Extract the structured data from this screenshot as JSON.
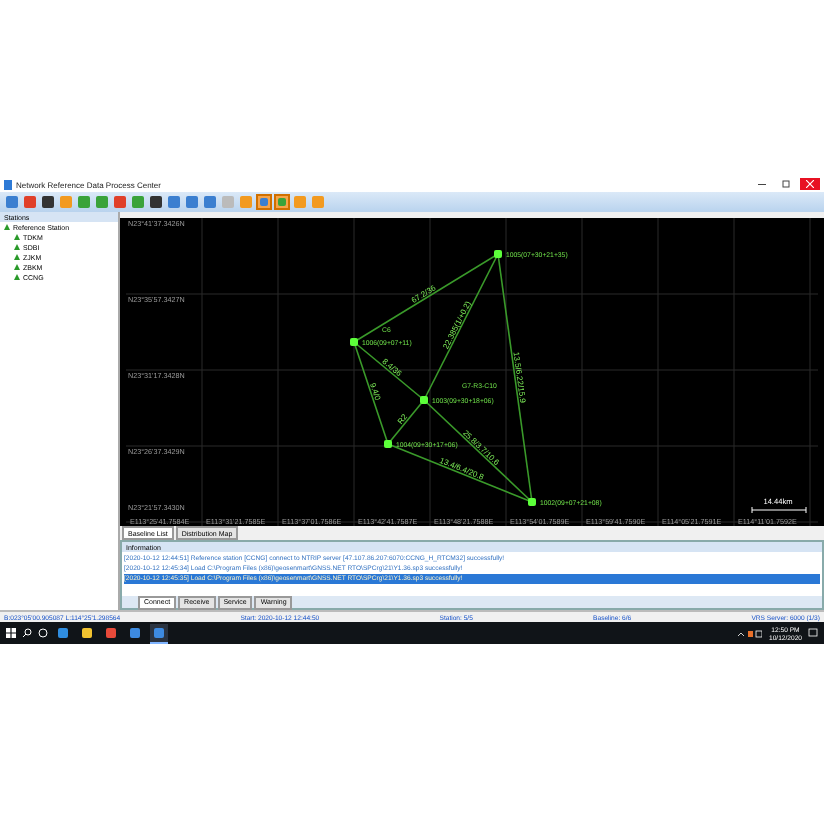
{
  "window": {
    "title": "Network Reference Data Process Center"
  },
  "toolbar": [
    {
      "kind": "blue",
      "selected": false
    },
    {
      "kind": "red",
      "selected": false
    },
    {
      "kind": "dark",
      "selected": false
    },
    {
      "kind": "orange",
      "selected": false
    },
    {
      "kind": "green",
      "selected": false
    },
    {
      "kind": "green",
      "selected": false
    },
    {
      "kind": "red",
      "selected": false
    },
    {
      "kind": "green",
      "selected": false
    },
    {
      "kind": "dark",
      "selected": false
    },
    {
      "kind": "blue",
      "selected": false
    },
    {
      "kind": "blue",
      "selected": false
    },
    {
      "kind": "blue",
      "selected": false
    },
    {
      "kind": "grey",
      "selected": false
    },
    {
      "kind": "orange",
      "selected": false
    },
    {
      "kind": "blue",
      "selected": true
    },
    {
      "kind": "green",
      "selected": true
    },
    {
      "kind": "orange",
      "selected": false
    },
    {
      "kind": "orange",
      "selected": false
    }
  ],
  "stations": {
    "title": "Stations",
    "root": "Reference Station",
    "children": [
      "TDKM",
      "SDBI",
      "ZJKM",
      "ZBKM",
      "CCNG"
    ]
  },
  "map": {
    "y_labels": [
      "N23°41'37.3426N",
      "N23°35'57.3427N",
      "N23°31'17.3428N",
      "N23°26'37.3429N",
      "N23°21'57.3430N"
    ],
    "x_labels": [
      "E113°25'41.7584E",
      "E113°31'21.7585E",
      "E113°37'01.7586E",
      "E113°42'41.7587E",
      "E113°48'21.7588E",
      "E113°54'01.7589E",
      "E113°59'41.7590E",
      "E114°05'21.7591E",
      "E114°11'01.7592E"
    ],
    "nodes": [
      {
        "label": "1005(07+30+21+35)"
      },
      {
        "label": "1006(09+07+11)"
      },
      {
        "label": "1003(09+30+18+06)"
      },
      {
        "label": "1004(09+30+17+06)"
      },
      {
        "label": "1002(09+07+21+08)"
      }
    ],
    "notes": [
      "C6",
      "G7-R3-C10"
    ],
    "edges": [
      {
        "label": "67.2/36"
      },
      {
        "label": "22.385(1/+0.2)"
      },
      {
        "label": "13.5/6.22/15.9"
      },
      {
        "label": "8.4/36"
      },
      {
        "label": "9.4/0"
      },
      {
        "label": "R2"
      },
      {
        "label": "25.8/3.7/10.6"
      },
      {
        "label": "13.4/6.4/20.8"
      }
    ],
    "scale": "14.44km"
  },
  "view_tabs": [
    {
      "label": "Baseline List",
      "selected": true
    },
    {
      "label": "Distribution Map",
      "selected": false
    }
  ],
  "information": {
    "title": "Information",
    "lines": [
      {
        "text": "[2020-10-12 12:44:51] Reference station [CCNG] connect to NTRIP server [47.107.86.207:6070:CCNG_H_RTCM32] successfully!",
        "selected": false
      },
      {
        "text": "[2020-10-12 12:45:34] Load C:\\Program Files (x86)\\geosenmart\\GNSS.NET RTO\\SPCrg\\21\\Y1.36.sp3 successfully!",
        "selected": false
      },
      {
        "text": "[2020-10-12 12:45:35] Load C:\\Program Files (x86)\\geosenmart\\GNSS.NET RTO\\SPCrg\\21\\Y1.36.sp3 successfully!",
        "selected": true
      }
    ]
  },
  "log_tabs": [
    {
      "label": "Connect",
      "selected": true
    },
    {
      "label": "Receive",
      "selected": false
    },
    {
      "label": "Service",
      "selected": false
    },
    {
      "label": "Warning",
      "selected": false
    }
  ],
  "status_bar": [
    "B:023°05'00.905087  L:114°25'1.298564",
    "Start: 2020-10-12 12:44:50",
    "Station: 5/5",
    "Baseline: 6/6",
    "VRS Server: 6000 (1/3)"
  ],
  "taskbar": {
    "apps": [
      {
        "kind": "edge",
        "selected": false
      },
      {
        "kind": "folder",
        "selected": false
      },
      {
        "kind": "chrome",
        "selected": false
      },
      {
        "kind": "app",
        "selected": false
      },
      {
        "kind": "app",
        "selected": true
      }
    ],
    "time": "12:50 PM",
    "date": "10/12/2020"
  }
}
